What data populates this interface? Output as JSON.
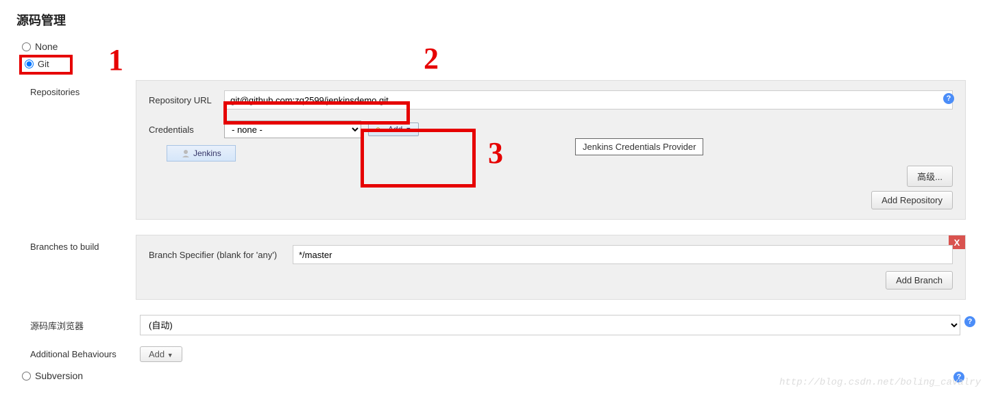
{
  "section_title": "源码管理",
  "scm": {
    "none_label": "None",
    "git_label": "Git",
    "subversion_label": "Subversion"
  },
  "repositories": {
    "section_label": "Repositories",
    "url_label": "Repository URL",
    "url_value": "git@github.com:zq2599/jenkinsdemo.git",
    "credentials_label": "Credentials",
    "credentials_value": "- none -",
    "add_label": "Add",
    "jenkins_option": "Jenkins",
    "tooltip": "Jenkins Credentials Provider",
    "advanced_btn": "高级...",
    "add_repo_btn": "Add Repository"
  },
  "branches": {
    "section_label": "Branches to build",
    "specifier_label": "Branch Specifier (blank for 'any')",
    "specifier_value": "*/master",
    "add_branch_btn": "Add Branch",
    "delete_x": "X"
  },
  "browser": {
    "label": "源码库浏览器",
    "value": "(自动)"
  },
  "behaviours": {
    "label": "Additional Behaviours",
    "add_btn": "Add"
  },
  "annotations": {
    "one": "1",
    "two": "2",
    "three": "3"
  },
  "watermark": "http://blog.csdn.net/boling_cavalry"
}
